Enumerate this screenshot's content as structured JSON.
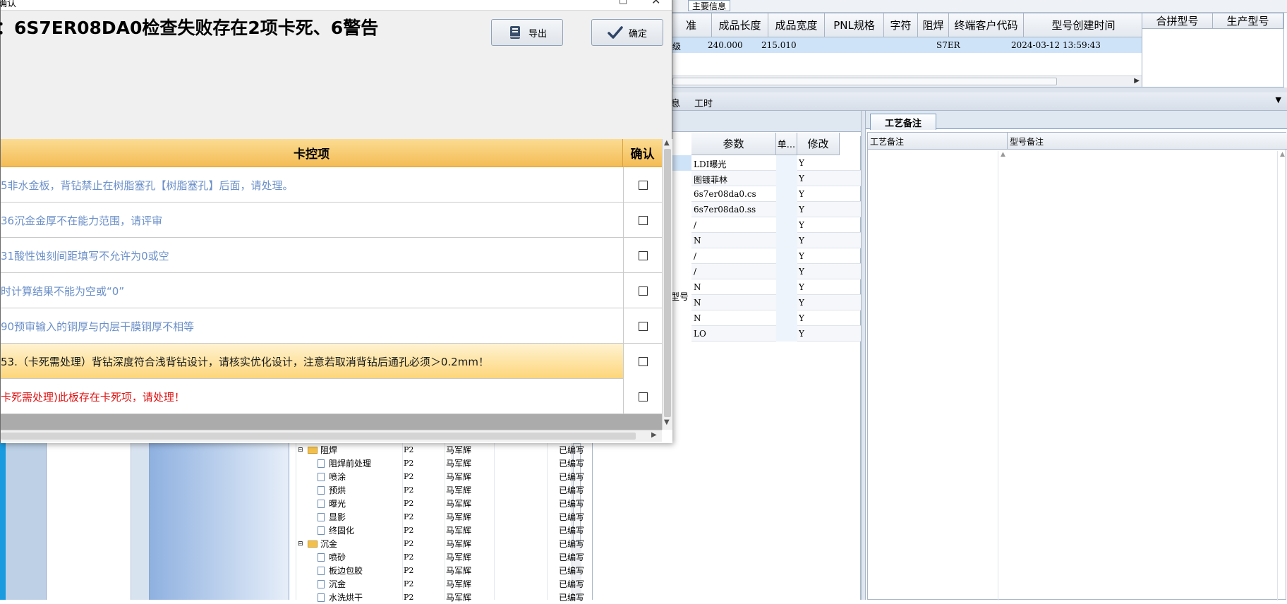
{
  "main_info": {
    "tab_label": "主要信息",
    "columns": [
      "准",
      "成品长度",
      "成品宽度",
      "PNL规格",
      "字符",
      "阻焊",
      "终端客户代码",
      "型号创建时间"
    ],
    "row": [
      "级",
      "240.000",
      "215.010",
      "",
      "",
      "",
      "S7ER",
      "2024-03-12 13:59:43"
    ],
    "right_columns": [
      "合拼型号",
      "生产型号"
    ]
  },
  "subtabs": [
    "息",
    "工时"
  ],
  "params": {
    "columns": [
      "参数",
      "单...",
      "修改"
    ],
    "side_label": "型号",
    "rows": [
      {
        "param": "LDI曝光",
        "modify": "Y"
      },
      {
        "param": "图镀菲林",
        "modify": "Y"
      },
      {
        "param": "6s7er08da0.cs",
        "modify": "Y"
      },
      {
        "param": "6s7er08da0.ss",
        "modify": "Y"
      },
      {
        "param": "/",
        "modify": "Y"
      },
      {
        "param": "N",
        "modify": "Y"
      },
      {
        "param": "/",
        "modify": "Y"
      },
      {
        "param": "/",
        "modify": "Y"
      },
      {
        "param": "N",
        "modify": "Y"
      },
      {
        "param": "N",
        "modify": "Y"
      },
      {
        "param": "N",
        "modify": "Y"
      },
      {
        "param": "LO",
        "modify": "Y"
      }
    ]
  },
  "remarks": {
    "tab_label": "工艺备注",
    "col1": "工艺备注",
    "col2": "型号备注"
  },
  "process_tree": [
    {
      "name": "阻焊",
      "level": 0,
      "code": "P2",
      "person": "马军辉",
      "status": "已编写"
    },
    {
      "name": "阻焊前处理",
      "level": 1,
      "code": "P2",
      "person": "马军辉",
      "status": "已编写"
    },
    {
      "name": "喷涂",
      "level": 1,
      "code": "P2",
      "person": "马军辉",
      "status": "已编写"
    },
    {
      "name": "预烘",
      "level": 1,
      "code": "P2",
      "person": "马军辉",
      "status": "已编写"
    },
    {
      "name": "曝光",
      "level": 1,
      "code": "P2",
      "person": "马军辉",
      "status": "已编写"
    },
    {
      "name": "显影",
      "level": 1,
      "code": "P2",
      "person": "马军辉",
      "status": "已编写"
    },
    {
      "name": "终固化",
      "level": 1,
      "code": "P2",
      "person": "马军辉",
      "status": "已编写"
    },
    {
      "name": "沉金",
      "level": 0,
      "code": "P2",
      "person": "马军辉",
      "status": "已编写"
    },
    {
      "name": "喷砂",
      "level": 1,
      "code": "P2",
      "person": "马军辉",
      "status": "已编写"
    },
    {
      "name": "板边包胶",
      "level": 1,
      "code": "P2",
      "person": "马军辉",
      "status": "已编写"
    },
    {
      "name": "沉金",
      "level": 1,
      "code": "P2",
      "person": "马军辉",
      "status": "已编写"
    },
    {
      "name": "水洗烘干",
      "level": 1,
      "code": "P2",
      "person": "马军辉",
      "status": "已编写"
    }
  ],
  "dialog": {
    "title": "确认",
    "message": "：6S7ER08DA0检查失败存在2项卡死、6警告",
    "export_label": "导出",
    "confirm_label": "确定",
    "col_item": "卡控项",
    "col_confirm": "确认",
    "items": [
      {
        "text": "5非水金板，背钻禁止在树脂塞孔【树脂塞孔】后面，请处理。",
        "type": "warn"
      },
      {
        "text": "36沉金金厚不在能力范围，请评审",
        "type": "warn"
      },
      {
        "text": "31酸性蚀刻间距填写不允许为0或空",
        "type": "warn"
      },
      {
        "text": "时计算结果不能为空或“0”",
        "type": "warn"
      },
      {
        "text": "90预审输入的铜厚与内层干膜铜厚不相等",
        "type": "warn"
      },
      {
        "text": "53.（卡死需处理）背钻深度符合浅背钻设计，请核实优化设计，注意若取消背钻后通孔必须＞0.2mm！",
        "type": "highlight"
      },
      {
        "text": "卡死需处理)此板存在卡死项，请处理！",
        "type": "error"
      }
    ]
  },
  "colors": {
    "warn_text": "#6a8fc9",
    "error_text": "#e01010",
    "highlight_bg": "#fdd67a",
    "header_bg": "#f7c86a",
    "selected_row": "#cfe3f8"
  },
  "icons": [
    "book-icon",
    "check-icon",
    "minimize-icon",
    "close-icon",
    "folder-icon",
    "file-icon",
    "scroll-up-icon",
    "scroll-down-icon",
    "scroll-right-icon",
    "dropdown-arrow-icon"
  ]
}
